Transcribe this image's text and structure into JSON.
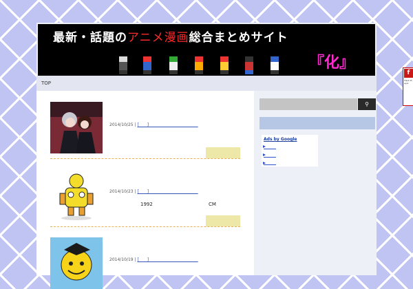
{
  "header": {
    "title_part1": "最新・話題の",
    "title_part2": "アニメ漫画",
    "title_part3": "総合まとめサイト",
    "title_badge": "『化』"
  },
  "nav": {
    "top_label": "TOP"
  },
  "posts": [
    {
      "date": "2014/10/25",
      "separator": "|",
      "link": "[____]____ ____ __ ___ ___ __ __"
    },
    {
      "date": "2014/10/23",
      "separator": "|",
      "link": "[____]____ ____ __ ___ ___ __ __",
      "note_year": "1992",
      "note_cm": "CM"
    },
    {
      "date": "2014/10/19",
      "separator": "|",
      "link": "[____]____ ____ __ ___ ___ __ __"
    }
  ],
  "sidebar": {
    "search_icon": "magnifier-icon",
    "ads_heading": "Ads by Google"
  },
  "flash": {
    "icon": "flash-player-icon",
    "text": "Flash Player"
  },
  "colors": {
    "background": "#bfc4f2",
    "banner_bg": "#000000",
    "title_accent": "#ff2a2a",
    "badge_color": "#ff2ad0",
    "post_divider": "#e9b050",
    "more_box": "#ede8a8",
    "sidebar_strip": "#b5c7e5"
  }
}
